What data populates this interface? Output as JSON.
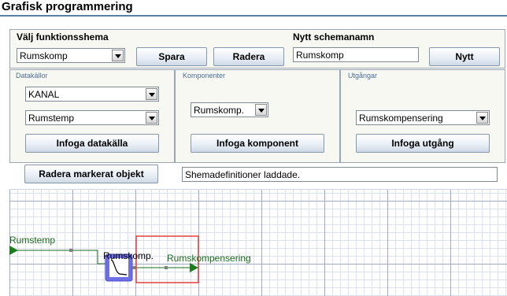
{
  "app": {
    "title": "Grafisk programmering"
  },
  "top": {
    "schema_label": "Välj funktionsshema",
    "schema_value": "Rumskomp",
    "save_label": "Spara",
    "delete_label": "Radera",
    "new_name_label": "Nytt schemanamn",
    "new_name_value": "Rumskomp",
    "new_label": "Nytt"
  },
  "sources": {
    "heading": "Datakällor",
    "select1_value": "KANAL",
    "select2_value": "Rumstemp",
    "insert_label": "Infoga datakälla"
  },
  "components": {
    "heading": "Komponenter",
    "select_value": "Rumskomp.",
    "insert_label": "Infoga komponent"
  },
  "outputs": {
    "heading": "Utgångar",
    "select_value": "Rumskompensering",
    "insert_label": "Infoga utgång"
  },
  "actions": {
    "delete_selected_label": "Radera markerat objekt",
    "status_text": "Shemadefinitioner laddade."
  },
  "diagram": {
    "source_label": "Rumstemp",
    "component_label": "Rumskomp.",
    "output_label": "Rumskompensering",
    "colors": {
      "wire": "#1b6b1b",
      "component_fill": "#7070e8",
      "selection": "#e04040",
      "port": "#808080"
    }
  }
}
